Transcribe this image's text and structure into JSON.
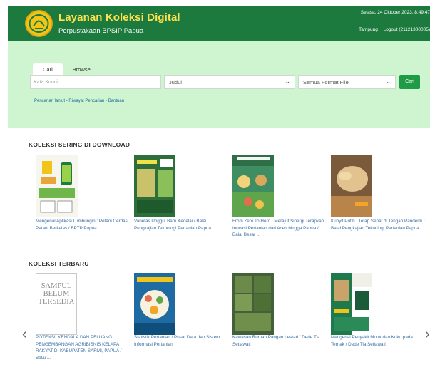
{
  "header": {
    "title": "Layanan Koleksi Digital",
    "subtitle": "Perpustakaan BPSIP Papua",
    "datetime": "Selasa, 24 Oktober 2023, 8:49:47",
    "user_links": [
      "Tampung",
      "Logout (21121300005)"
    ]
  },
  "search": {
    "tabs": [
      "Cari",
      "Browse"
    ],
    "keyword_placeholder": "Kata Kunci",
    "field_select": "Judul",
    "format_select": "Semua Format File",
    "submit_label": "Cari",
    "sub_links": "Pencarian lanjut - Riwayat Pencarian - Bantuan"
  },
  "sections": [
    {
      "title": "KOLEKSI SERING DI DOWNLOAD",
      "items": [
        {
          "caption": "Mengenal Aplikasi Lumbungin : Petani Cerdas, Petani Berkelas / BPTP Papua"
        },
        {
          "caption": "Varietas Unggul Baru Kedelai / Balai Pengkajian Teknologi Pertanian Papua"
        },
        {
          "caption": "From Zero To Hero : Merajut Sinergi Terapkan Inovasi Pertanian dari Aceh hingga Papua / Balai Besar ..."
        },
        {
          "caption": "Kunyit Putih : Tetap Sehat di Tengah Pandemi / Balai Pengkajian Teknologi Pertanian Papua"
        }
      ]
    },
    {
      "title": "KOLEKSI TERBARU",
      "items": [
        {
          "caption": "POTENSI, KENDALA DAN PELUANG PENGEMBANGAN AGRIBISNIS KELAPA RAKYAT DI KABUPATEN SARMI, PAPUA / Balai ...",
          "cover_text": [
            "SAMPUL",
            "BELUM",
            "TERSEDIA"
          ]
        },
        {
          "caption": "Statistik Pertanian / Pusat Data dan Sistem Informasi Pertanian"
        },
        {
          "caption": "Kawasan Rumah Pangan Lestari / Dede Tia Setiawati"
        },
        {
          "caption": "Mengenal Penyakit Mulut dan Kuku pada Ternak / Dede Tia Setiawati"
        }
      ]
    }
  ],
  "carousel": {
    "prev": "‹",
    "next": "›"
  }
}
